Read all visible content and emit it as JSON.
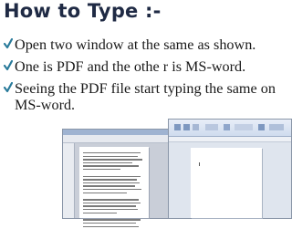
{
  "slide": {
    "title": "How to Type :-",
    "bullets": [
      "Open two window at the same as shown.",
      "One is PDF and the othe r is MS-word.",
      "Seeing the PDF file start typing the same on MS-word."
    ]
  },
  "colors": {
    "bullet": "#2a7b9b",
    "title": "#1f2a44"
  }
}
